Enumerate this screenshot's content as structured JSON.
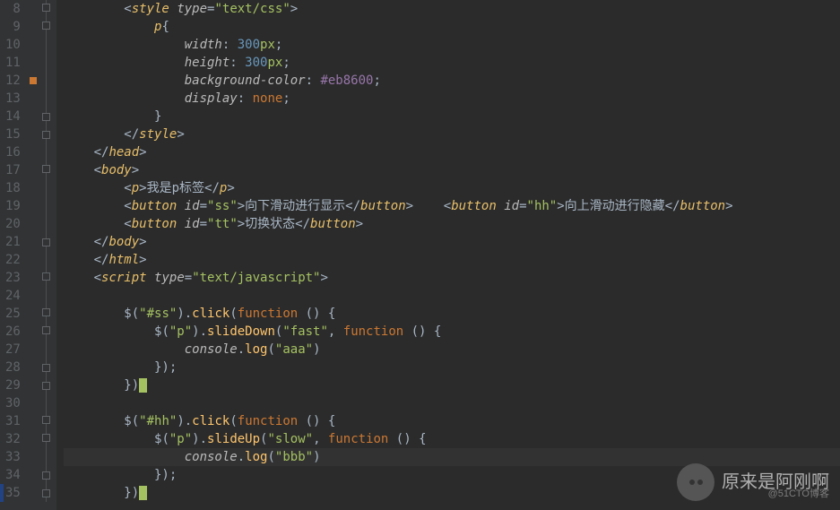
{
  "lines": [
    {
      "n": 8,
      "html": "        &lt;<span class='tag'>style</span> <span class='attr'>type</span>=<span class='str'>\"text/css\"</span>&gt;"
    },
    {
      "n": 9,
      "html": "            <span class='sel'>p</span>{"
    },
    {
      "n": 10,
      "html": "                <span class='prop'>width</span>: <span class='num'>300</span><span class='px'>px</span>;"
    },
    {
      "n": 11,
      "html": "                <span class='prop'>height</span>: <span class='num'>300</span><span class='px'>px</span>;"
    },
    {
      "n": 12,
      "mark": true,
      "html": "                <span class='prop'>background-color</span>: <span class='hex'>#eb8600</span>;"
    },
    {
      "n": 13,
      "html": "                <span class='prop'>display</span>: <span class='kw'>none</span>;"
    },
    {
      "n": 14,
      "html": "            }"
    },
    {
      "n": 15,
      "html": "        &lt;/<span class='tag'>style</span>&gt;"
    },
    {
      "n": 16,
      "html": "    &lt;/<span class='tag'>head</span>&gt;"
    },
    {
      "n": 17,
      "html": "    &lt;<span class='tag'>body</span>&gt;"
    },
    {
      "n": 18,
      "html": "        &lt;<span class='tag'>p</span>&gt;我是p标签&lt;/<span class='tag'>p</span>&gt;"
    },
    {
      "n": 19,
      "html": "        &lt;<span class='tag'>button</span> <span class='attr'>id</span>=<span class='str'>\"ss\"</span>&gt;向下滑动进行显示&lt;/<span class='tag'>button</span>&gt;    &lt;<span class='tag'>button</span> <span class='attr'>id</span>=<span class='str'>\"hh\"</span>&gt;向上滑动进行隐藏&lt;/<span class='tag'>button</span>&gt;"
    },
    {
      "n": 20,
      "html": "        &lt;<span class='tag'>button</span> <span class='attr'>id</span>=<span class='str'>\"tt\"</span>&gt;切换状态&lt;/<span class='tag'>button</span>&gt;"
    },
    {
      "n": 21,
      "html": "    &lt;/<span class='tag'>body</span>&gt;"
    },
    {
      "n": 22,
      "html": "    &lt;/<span class='tag'>html</span>&gt;"
    },
    {
      "n": 23,
      "html": "    &lt;<span class='tag'>script</span> <span class='attr'>type</span>=<span class='str'>\"text/javascript\"</span>&gt;"
    },
    {
      "n": 24,
      "html": ""
    },
    {
      "n": 25,
      "html": "        <span class='jq'>$(</span><span class='str'>\"#ss\"</span><span class='jq'>).</span><span class='fn'>click</span>(<span class='jk'>function </span>() {"
    },
    {
      "n": 26,
      "html": "            <span class='jq'>$(</span><span class='str'>\"p\"</span><span class='jq'>).</span><span class='fn'>slideDown</span>(<span class='str'>\"fast\"</span>, <span class='jk'>function </span>() {"
    },
    {
      "n": 27,
      "html": "                <span class='prop'>console</span>.<span class='fn'>log</span>(<span class='str'>\"aaa\"</span>)"
    },
    {
      "n": 28,
      "html": "            });"
    },
    {
      "n": 29,
      "html": "        })<span class='caret'> </span>"
    },
    {
      "n": 30,
      "html": ""
    },
    {
      "n": 31,
      "html": "        <span class='jq'>$(</span><span class='str'>\"#hh\"</span><span class='jq'>).</span><span class='fn'>click</span>(<span class='jk'>function </span>() {"
    },
    {
      "n": 32,
      "html": "            <span class='jq'>$(</span><span class='str'>\"p\"</span><span class='jq'>).</span><span class='fn'>slideUp</span>(<span class='str'>\"slow\"</span>, <span class='jk'>function </span>() {"
    },
    {
      "n": 33,
      "current": true,
      "html": "                <span class='prop'>console</span>.<span class='fn'>log</span>(<span class='str'>\"bbb\"</span>)"
    },
    {
      "n": 34,
      "html": "            });"
    },
    {
      "n": 35,
      "html": "        })<span class='caret'> </span>"
    }
  ],
  "watermark": {
    "main": "原来是阿刚啊",
    "sub": "@51CTO博客"
  }
}
